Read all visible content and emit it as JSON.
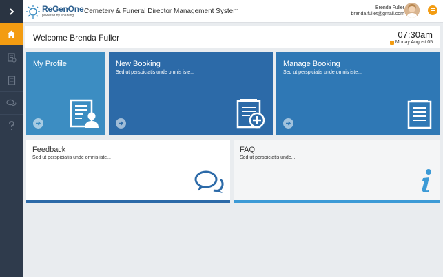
{
  "colors": {
    "sidebar": "#2f3b4c",
    "accent": "#f39c12",
    "tile_profile": "#3c8dc2",
    "tile_new_booking": "#2c6aa8",
    "tile_manage_booking": "#2f78b5",
    "faq_icon": "#3c9ad6"
  },
  "sidebar": {
    "items": [
      {
        "icon": "chevron-right-icon"
      },
      {
        "icon": "home-icon",
        "active": true
      },
      {
        "icon": "booking-icon"
      },
      {
        "icon": "document-icon"
      },
      {
        "icon": "chat-icon"
      },
      {
        "icon": "help-icon"
      }
    ]
  },
  "header": {
    "logo_name": "ReGenOne",
    "logo_sub": "powered by enabling",
    "app_title": "Cemetery & Funeral Director Management System",
    "user_name": "Brenda Fuller",
    "user_email": "brenda.fullet@gmail.com"
  },
  "welcome": {
    "text": "Welcome Brenda Fuller",
    "time": "07:30am",
    "date": "Monay August 05"
  },
  "tiles": {
    "profile": {
      "title": "My Profile",
      "icon": "profile-document-icon"
    },
    "new_booking": {
      "title": "New Booking",
      "desc": "Sed ut perspiciatis unde omnis iste...",
      "icon": "add-document-icon"
    },
    "manage_booking": {
      "title": "Manage Booking",
      "desc": "Sed ut perspiciatis unde omnis iste...",
      "icon": "document-icon"
    },
    "feedback": {
      "title": "Feedback",
      "desc": "Sed ut perspiciatis unde omnis iste...",
      "icon": "chat-bubbles-icon"
    },
    "faq": {
      "title": "FAQ",
      "desc": "Sed ut perspiciatis unde...",
      "icon": "info-icon"
    }
  }
}
